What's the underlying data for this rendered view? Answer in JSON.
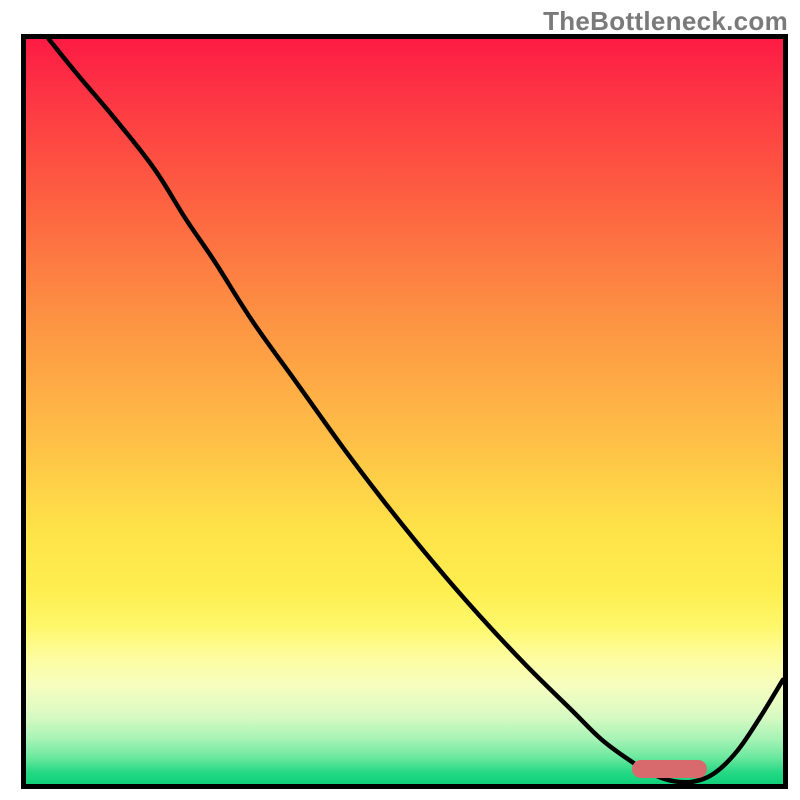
{
  "watermark": "TheBottleneck.com",
  "colors": {
    "frame": "#000000",
    "curve": "#000000",
    "marker": "#d86a6d"
  },
  "chart_data": {
    "type": "line",
    "title": "",
    "xlabel": "",
    "ylabel": "",
    "xlim": [
      0,
      100
    ],
    "ylim": [
      0,
      100
    ],
    "x": [
      3,
      7,
      12,
      17,
      21,
      25,
      30,
      36,
      42,
      48,
      54,
      60,
      66,
      72,
      76,
      80,
      82.5,
      85,
      88,
      91,
      94,
      97,
      100
    ],
    "y": [
      100,
      95,
      89,
      82.5,
      76,
      70,
      62,
      53.5,
      45,
      37,
      29.5,
      22.5,
      16,
      10,
      6,
      3,
      1.5,
      0.5,
      0.3,
      1.5,
      4.5,
      9,
      14
    ],
    "marker_range_x": [
      80,
      90
    ],
    "note": "Heat-gradient bottleneck chart; curve starts at top-left, bends near x≈25, descends linearly to a minimum around x≈85–87, then rises toward the right edge. A rounded salmon bar marks the optimal zone near the bottom."
  }
}
